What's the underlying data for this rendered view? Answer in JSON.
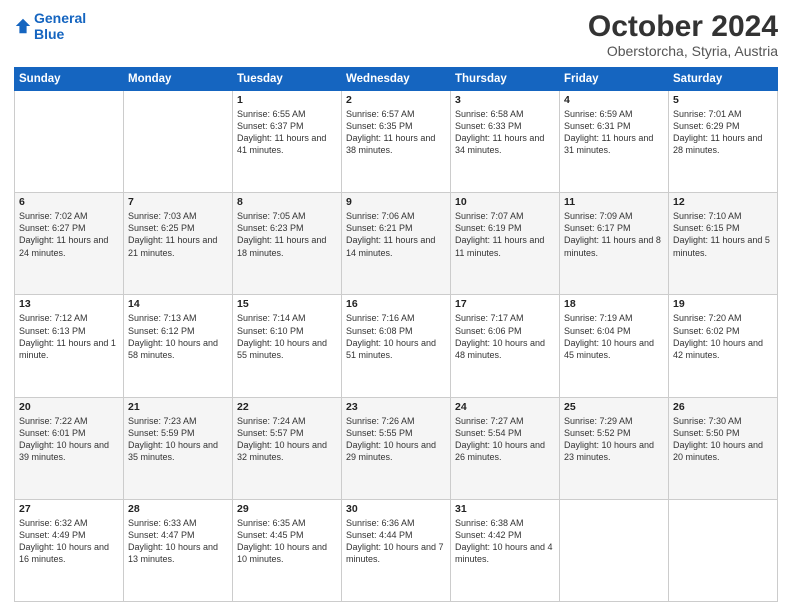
{
  "logo": {
    "line1": "General",
    "line2": "Blue"
  },
  "title": "October 2024",
  "location": "Oberstorcha, Styria, Austria",
  "weekdays": [
    "Sunday",
    "Monday",
    "Tuesday",
    "Wednesday",
    "Thursday",
    "Friday",
    "Saturday"
  ],
  "weeks": [
    [
      {
        "day": "",
        "info": ""
      },
      {
        "day": "",
        "info": ""
      },
      {
        "day": "1",
        "info": "Sunrise: 6:55 AM\nSunset: 6:37 PM\nDaylight: 11 hours and 41 minutes."
      },
      {
        "day": "2",
        "info": "Sunrise: 6:57 AM\nSunset: 6:35 PM\nDaylight: 11 hours and 38 minutes."
      },
      {
        "day": "3",
        "info": "Sunrise: 6:58 AM\nSunset: 6:33 PM\nDaylight: 11 hours and 34 minutes."
      },
      {
        "day": "4",
        "info": "Sunrise: 6:59 AM\nSunset: 6:31 PM\nDaylight: 11 hours and 31 minutes."
      },
      {
        "day": "5",
        "info": "Sunrise: 7:01 AM\nSunset: 6:29 PM\nDaylight: 11 hours and 28 minutes."
      }
    ],
    [
      {
        "day": "6",
        "info": "Sunrise: 7:02 AM\nSunset: 6:27 PM\nDaylight: 11 hours and 24 minutes."
      },
      {
        "day": "7",
        "info": "Sunrise: 7:03 AM\nSunset: 6:25 PM\nDaylight: 11 hours and 21 minutes."
      },
      {
        "day": "8",
        "info": "Sunrise: 7:05 AM\nSunset: 6:23 PM\nDaylight: 11 hours and 18 minutes."
      },
      {
        "day": "9",
        "info": "Sunrise: 7:06 AM\nSunset: 6:21 PM\nDaylight: 11 hours and 14 minutes."
      },
      {
        "day": "10",
        "info": "Sunrise: 7:07 AM\nSunset: 6:19 PM\nDaylight: 11 hours and 11 minutes."
      },
      {
        "day": "11",
        "info": "Sunrise: 7:09 AM\nSunset: 6:17 PM\nDaylight: 11 hours and 8 minutes."
      },
      {
        "day": "12",
        "info": "Sunrise: 7:10 AM\nSunset: 6:15 PM\nDaylight: 11 hours and 5 minutes."
      }
    ],
    [
      {
        "day": "13",
        "info": "Sunrise: 7:12 AM\nSunset: 6:13 PM\nDaylight: 11 hours and 1 minute."
      },
      {
        "day": "14",
        "info": "Sunrise: 7:13 AM\nSunset: 6:12 PM\nDaylight: 10 hours and 58 minutes."
      },
      {
        "day": "15",
        "info": "Sunrise: 7:14 AM\nSunset: 6:10 PM\nDaylight: 10 hours and 55 minutes."
      },
      {
        "day": "16",
        "info": "Sunrise: 7:16 AM\nSunset: 6:08 PM\nDaylight: 10 hours and 51 minutes."
      },
      {
        "day": "17",
        "info": "Sunrise: 7:17 AM\nSunset: 6:06 PM\nDaylight: 10 hours and 48 minutes."
      },
      {
        "day": "18",
        "info": "Sunrise: 7:19 AM\nSunset: 6:04 PM\nDaylight: 10 hours and 45 minutes."
      },
      {
        "day": "19",
        "info": "Sunrise: 7:20 AM\nSunset: 6:02 PM\nDaylight: 10 hours and 42 minutes."
      }
    ],
    [
      {
        "day": "20",
        "info": "Sunrise: 7:22 AM\nSunset: 6:01 PM\nDaylight: 10 hours and 39 minutes."
      },
      {
        "day": "21",
        "info": "Sunrise: 7:23 AM\nSunset: 5:59 PM\nDaylight: 10 hours and 35 minutes."
      },
      {
        "day": "22",
        "info": "Sunrise: 7:24 AM\nSunset: 5:57 PM\nDaylight: 10 hours and 32 minutes."
      },
      {
        "day": "23",
        "info": "Sunrise: 7:26 AM\nSunset: 5:55 PM\nDaylight: 10 hours and 29 minutes."
      },
      {
        "day": "24",
        "info": "Sunrise: 7:27 AM\nSunset: 5:54 PM\nDaylight: 10 hours and 26 minutes."
      },
      {
        "day": "25",
        "info": "Sunrise: 7:29 AM\nSunset: 5:52 PM\nDaylight: 10 hours and 23 minutes."
      },
      {
        "day": "26",
        "info": "Sunrise: 7:30 AM\nSunset: 5:50 PM\nDaylight: 10 hours and 20 minutes."
      }
    ],
    [
      {
        "day": "27",
        "info": "Sunrise: 6:32 AM\nSunset: 4:49 PM\nDaylight: 10 hours and 16 minutes."
      },
      {
        "day": "28",
        "info": "Sunrise: 6:33 AM\nSunset: 4:47 PM\nDaylight: 10 hours and 13 minutes."
      },
      {
        "day": "29",
        "info": "Sunrise: 6:35 AM\nSunset: 4:45 PM\nDaylight: 10 hours and 10 minutes."
      },
      {
        "day": "30",
        "info": "Sunrise: 6:36 AM\nSunset: 4:44 PM\nDaylight: 10 hours and 7 minutes."
      },
      {
        "day": "31",
        "info": "Sunrise: 6:38 AM\nSunset: 4:42 PM\nDaylight: 10 hours and 4 minutes."
      },
      {
        "day": "",
        "info": ""
      },
      {
        "day": "",
        "info": ""
      }
    ]
  ]
}
